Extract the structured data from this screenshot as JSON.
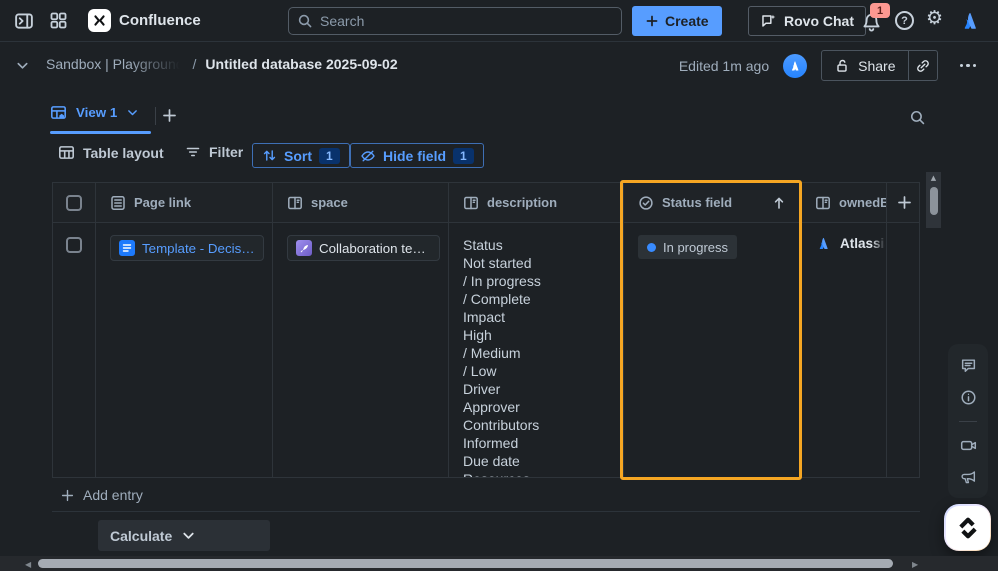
{
  "topbar": {
    "app_name": "Confluence",
    "search_placeholder": "Search",
    "create_label": "Create",
    "rovo_chat_label": "Rovo Chat",
    "notification_badge": "1"
  },
  "page_header": {
    "breadcrumb": "Sandbox | Playground",
    "separator": "/",
    "title": "Untitled database 2025-09-02",
    "edited": "Edited 1m ago",
    "share_label": "Share"
  },
  "view_bar": {
    "view_tab": "View 1"
  },
  "toolbar": {
    "table_layout_label": "Table layout",
    "filter_label": "Filter",
    "sort_label": "Sort",
    "sort_count": "1",
    "hide_field_label": "Hide field",
    "hide_field_count": "1"
  },
  "table": {
    "columns": {
      "page_link": "Page link",
      "space": "space",
      "description": "description",
      "status": "Status field",
      "owned_by": "ownedBy"
    },
    "row": {
      "page_link": "Template - Decisio...",
      "space": "Collaboration temp.",
      "description_lines": [
        "Status",
        "Not started",
        "/ In progress",
        "/ Complete",
        "Impact",
        "High",
        "/ Medium",
        "/ Low",
        "Driver",
        "Approver",
        "Contributors",
        "Informed",
        "Due date",
        "Resources"
      ],
      "status": "In progress",
      "owned_by": "Atlassian Sup"
    },
    "add_entry_label": "Add entry",
    "calculate_label": "Calculate"
  },
  "colors": {
    "accent_blue": "#579DFF",
    "column_highlight_orange": "#F5A623",
    "notification_badge_pink": "#FD9891",
    "status_dot_blue": "#388BFF"
  }
}
